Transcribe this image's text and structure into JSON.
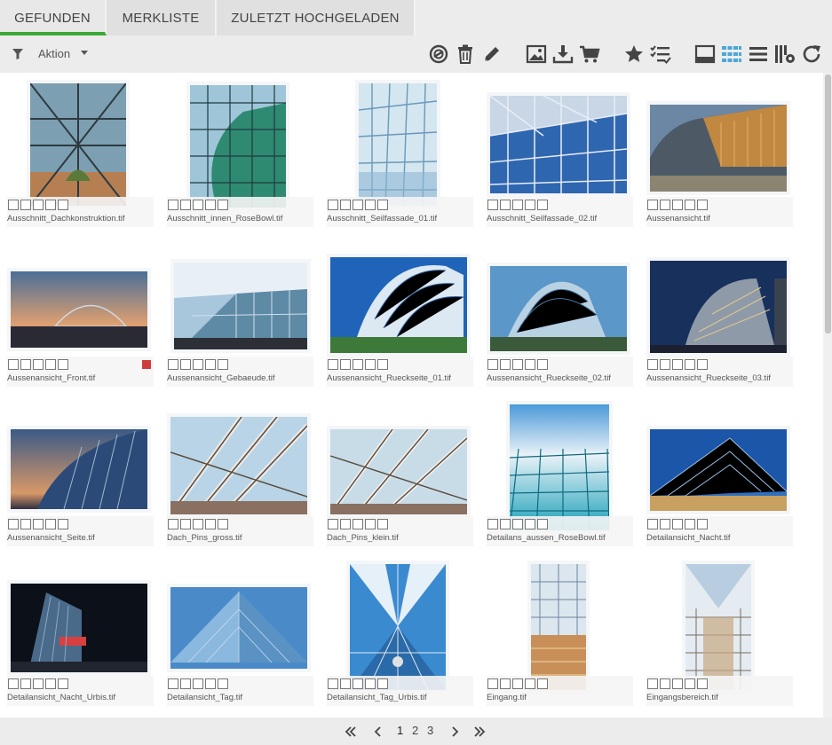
{
  "tabs": [
    {
      "label": "GEFUNDEN",
      "active": true
    },
    {
      "label": "MERKLISTE",
      "active": false
    },
    {
      "label": "ZULETZT HOCHGELADEN",
      "active": false
    }
  ],
  "toolbar": {
    "action_label": "Aktion",
    "icons": [
      "unlink-icon",
      "trash-icon",
      "pencil-icon",
      "image-icon",
      "download-icon",
      "cart-icon",
      "star-icon",
      "checklist-icon",
      "single-view-icon",
      "grid-view-icon",
      "list-view-icon",
      "column-settings-icon",
      "refresh-icon"
    ]
  },
  "colors": {
    "accent": "#3aa935",
    "flag": "#d03c3c"
  },
  "assets": [
    {
      "name": "Ausschnitt_Dachkonstruktion.tif",
      "flag": false
    },
    {
      "name": "Ausschnitt_innen_RoseBowl.tif",
      "flag": false
    },
    {
      "name": "Ausschnitt_Seilfassade_01.tif",
      "flag": false
    },
    {
      "name": "Ausschnitt_Seilfassade_02.tif",
      "flag": false
    },
    {
      "name": "Aussenansicht.tif",
      "flag": false
    },
    {
      "name": "Aussenansicht_Front.tif",
      "flag": true
    },
    {
      "name": "Aussenansicht_Gebaeude.tif",
      "flag": false
    },
    {
      "name": "Aussenansicht_Rueckseite_01.tif",
      "flag": false
    },
    {
      "name": "Aussenansicht_Rueckseite_02.tif",
      "flag": false
    },
    {
      "name": "Aussenansicht_Rueckseite_03.tif",
      "flag": false
    },
    {
      "name": "Aussenansicht_Seite.tif",
      "flag": false
    },
    {
      "name": "Dach_Pins_gross.tif",
      "flag": false
    },
    {
      "name": "Dach_Pins_klein.tif",
      "flag": false
    },
    {
      "name": "Detailans_aussen_RoseBowl.tif",
      "flag": false
    },
    {
      "name": "Detailansicht_Nacht.tif",
      "flag": false
    },
    {
      "name": "Detailansicht_Nacht_Urbis.tif",
      "flag": false
    },
    {
      "name": "Detailansicht_Tag.tif",
      "flag": false
    },
    {
      "name": "Detailansicht_Tag_Urbis.tif",
      "flag": false
    },
    {
      "name": "Eingang.tif",
      "flag": false
    },
    {
      "name": "Eingangsbereich.tif",
      "flag": false
    }
  ],
  "pagination": {
    "pages": [
      "1",
      "2",
      "3"
    ],
    "current": "1"
  }
}
